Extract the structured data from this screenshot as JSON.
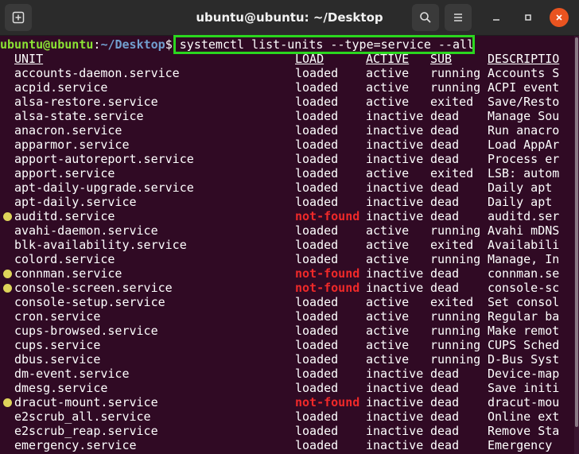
{
  "window": {
    "title": "ubuntu@ubuntu: ~/Desktop"
  },
  "icons": [
    "new-tab-icon",
    "search-icon",
    "menu-icon",
    "minimize-icon",
    "maximize-icon",
    "close-icon"
  ],
  "colors": {
    "background": "#300a24",
    "prompt_user": "#8ae234",
    "prompt_path": "#729fcf",
    "not_found": "#ef2929",
    "highlight_box": "#2bd61f",
    "dot": "#ddd45a"
  },
  "prompt": {
    "user": "ubuntu@ubuntu",
    "colon": ":",
    "path": "~/Desktop",
    "dollar": "$",
    "command": " systemctl list-units --type=service --all"
  },
  "headers": {
    "unit": "UNIT",
    "load": "LOAD",
    "active": "ACTIVE",
    "sub": "SUB",
    "description": "DESCRIPTIO"
  },
  "rows": [
    {
      "unit": "accounts-daemon.service",
      "load": "loaded",
      "active": "active",
      "sub": "running",
      "desc": "Accounts S"
    },
    {
      "unit": "acpid.service",
      "load": "loaded",
      "active": "active",
      "sub": "running",
      "desc": "ACPI event"
    },
    {
      "unit": "alsa-restore.service",
      "load": "loaded",
      "active": "active",
      "sub": "exited",
      "desc": "Save/Resto"
    },
    {
      "unit": "alsa-state.service",
      "load": "loaded",
      "active": "inactive",
      "sub": "dead",
      "desc": "Manage Sou"
    },
    {
      "unit": "anacron.service",
      "load": "loaded",
      "active": "inactive",
      "sub": "dead",
      "desc": "Run anacro"
    },
    {
      "unit": "apparmor.service",
      "load": "loaded",
      "active": "inactive",
      "sub": "dead",
      "desc": "Load AppAr"
    },
    {
      "unit": "apport-autoreport.service",
      "load": "loaded",
      "active": "inactive",
      "sub": "dead",
      "desc": "Process er"
    },
    {
      "unit": "apport.service",
      "load": "loaded",
      "active": "active",
      "sub": "exited",
      "desc": "LSB: autom"
    },
    {
      "unit": "apt-daily-upgrade.service",
      "load": "loaded",
      "active": "inactive",
      "sub": "dead",
      "desc": "Daily apt "
    },
    {
      "unit": "apt-daily.service",
      "load": "loaded",
      "active": "inactive",
      "sub": "dead",
      "desc": "Daily apt "
    },
    {
      "unit": "auditd.service",
      "load": "not-found",
      "active": "inactive",
      "sub": "dead",
      "desc": "auditd.ser"
    },
    {
      "unit": "avahi-daemon.service",
      "load": "loaded",
      "active": "active",
      "sub": "running",
      "desc": "Avahi mDNS"
    },
    {
      "unit": "blk-availability.service",
      "load": "loaded",
      "active": "active",
      "sub": "exited",
      "desc": "Availabili"
    },
    {
      "unit": "colord.service",
      "load": "loaded",
      "active": "active",
      "sub": "running",
      "desc": "Manage, In"
    },
    {
      "unit": "connman.service",
      "load": "not-found",
      "active": "inactive",
      "sub": "dead",
      "desc": "connman.se"
    },
    {
      "unit": "console-screen.service",
      "load": "not-found",
      "active": "inactive",
      "sub": "dead",
      "desc": "console-sc"
    },
    {
      "unit": "console-setup.service",
      "load": "loaded",
      "active": "active",
      "sub": "exited",
      "desc": "Set consol"
    },
    {
      "unit": "cron.service",
      "load": "loaded",
      "active": "active",
      "sub": "running",
      "desc": "Regular ba"
    },
    {
      "unit": "cups-browsed.service",
      "load": "loaded",
      "active": "active",
      "sub": "running",
      "desc": "Make remot"
    },
    {
      "unit": "cups.service",
      "load": "loaded",
      "active": "active",
      "sub": "running",
      "desc": "CUPS Sched"
    },
    {
      "unit": "dbus.service",
      "load": "loaded",
      "active": "active",
      "sub": "running",
      "desc": "D-Bus Syst"
    },
    {
      "unit": "dm-event.service",
      "load": "loaded",
      "active": "inactive",
      "sub": "dead",
      "desc": "Device-map"
    },
    {
      "unit": "dmesg.service",
      "load": "loaded",
      "active": "inactive",
      "sub": "dead",
      "desc": "Save initi"
    },
    {
      "unit": "dracut-mount.service",
      "load": "not-found",
      "active": "inactive",
      "sub": "dead",
      "desc": "dracut-mou"
    },
    {
      "unit": "e2scrub_all.service",
      "load": "loaded",
      "active": "inactive",
      "sub": "dead",
      "desc": "Online ext"
    },
    {
      "unit": "e2scrub_reap.service",
      "load": "loaded",
      "active": "inactive",
      "sub": "dead",
      "desc": "Remove Sta"
    },
    {
      "unit": "emergency.service",
      "load": "loaded",
      "active": "inactive",
      "sub": "dead",
      "desc": "Emergency "
    }
  ]
}
